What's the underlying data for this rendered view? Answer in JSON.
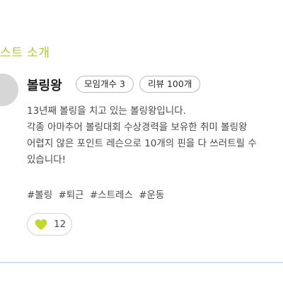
{
  "section": {
    "title": "스트 소개"
  },
  "host": {
    "name": "볼링왕",
    "badges": {
      "meetings": "모임개수 3",
      "reviews": "리뷰 100개"
    },
    "description": [
      "13년째 볼링을 치고 있는 볼링왕입니다.",
      "각종 아마추어 볼링대회 수상경력을 보유한 취미 볼링왕",
      "어렵지 않은 포인트 레슨으로 10개의 핀을 다 쓰러트릴 수",
      "있습니다!"
    ],
    "tags": [
      "#볼링",
      "#퇴근",
      "#스트레스",
      "#운동"
    ],
    "likes": {
      "icon": "heart-icon",
      "count": "12"
    }
  },
  "colors": {
    "accent": "#b9c82a",
    "heart": "#c4d72b",
    "divider": "#cfe0f2"
  }
}
